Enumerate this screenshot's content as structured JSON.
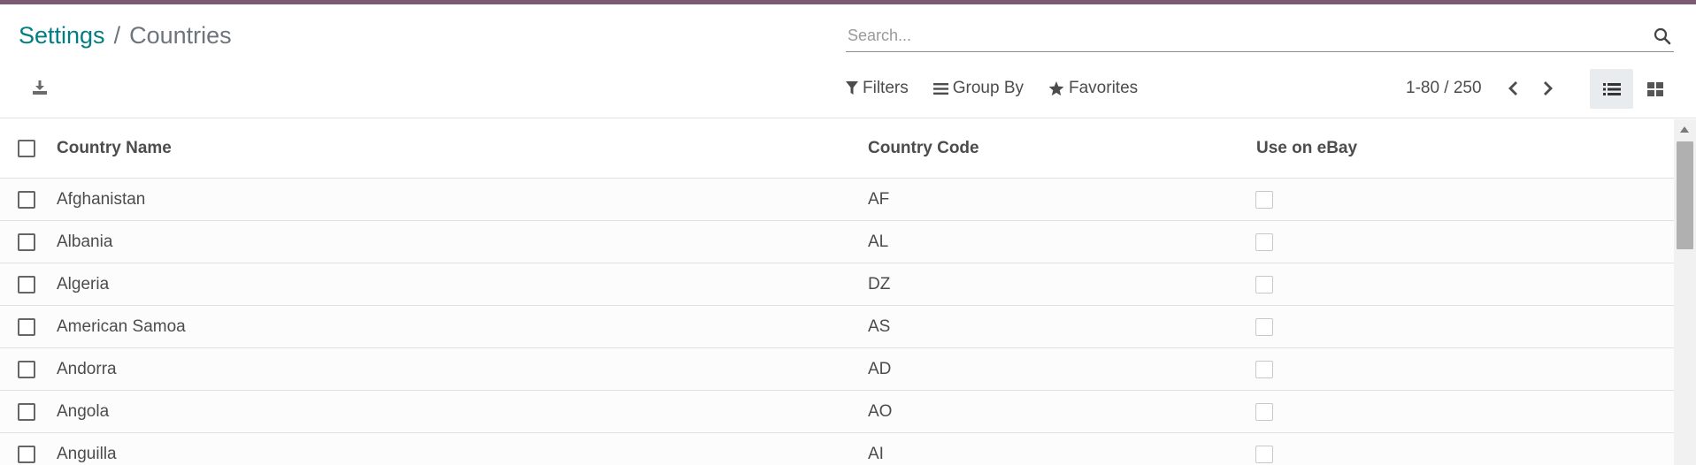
{
  "breadcrumb": {
    "parent": "Settings",
    "separator": "/",
    "current": "Countries"
  },
  "search": {
    "placeholder": "Search...",
    "value": ""
  },
  "facets": {
    "filters": "Filters",
    "group_by": "Group By",
    "favorites": "Favorites"
  },
  "pager": {
    "value": "1-80 / 250"
  },
  "views": {
    "active": "list"
  },
  "table": {
    "columns": [
      "Country Name",
      "Country Code",
      "Use on eBay"
    ],
    "rows": [
      {
        "name": "Afghanistan",
        "code": "AF",
        "use_on_ebay": false
      },
      {
        "name": "Albania",
        "code": "AL",
        "use_on_ebay": false
      },
      {
        "name": "Algeria",
        "code": "DZ",
        "use_on_ebay": false
      },
      {
        "name": "American Samoa",
        "code": "AS",
        "use_on_ebay": false
      },
      {
        "name": "Andorra",
        "code": "AD",
        "use_on_ebay": false
      },
      {
        "name": "Angola",
        "code": "AO",
        "use_on_ebay": false
      },
      {
        "name": "Anguilla",
        "code": "AI",
        "use_on_ebay": false
      }
    ]
  },
  "colors": {
    "accent_bar": "#7c5a75",
    "breadcrumb_link": "#017e84"
  }
}
